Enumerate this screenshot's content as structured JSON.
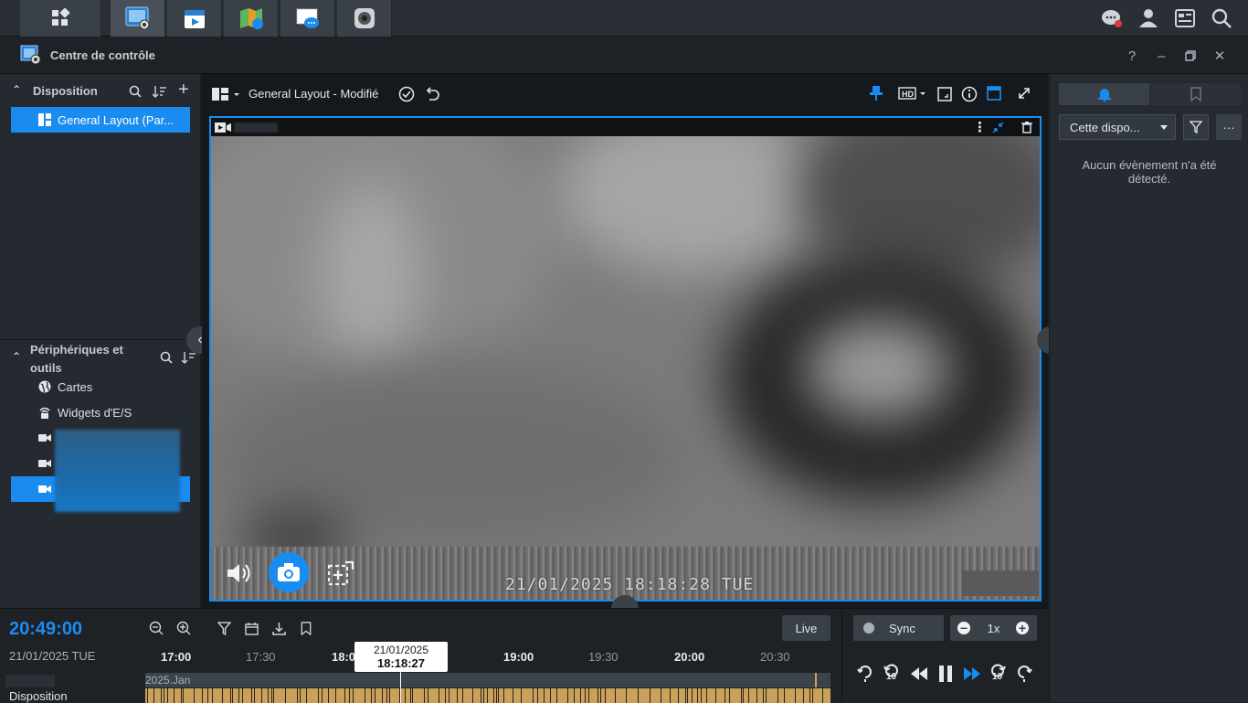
{
  "window": {
    "title": "Centre de contrôle"
  },
  "colors": {
    "accent": "#1a8cf0",
    "archive": "#c9a15a",
    "notify_dot": "#e23a3a"
  },
  "left_panel": {
    "layout_section": {
      "title": "Disposition",
      "items": [
        {
          "label": "General Layout (Par..."
        }
      ]
    },
    "devices_section": {
      "title_line1": "Périphériques et",
      "title_line2": "outils",
      "items": [
        {
          "label": "Cartes",
          "icon": "globe-icon"
        },
        {
          "label": "Widgets d'E/S",
          "icon": "io-widget-icon"
        }
      ]
    }
  },
  "center": {
    "layout_name": "General Layout - Modifié"
  },
  "video": {
    "timestamp": "21/01/2025 18:18:28 TUE"
  },
  "right_panel": {
    "filter_select": "Cette dispo...",
    "empty_message": "Aucun évènement n'a été détecté."
  },
  "timeline": {
    "current_time": "20:49:00",
    "current_date": "21/01/2025 TUE",
    "live_label": "Live",
    "cursor_date": "21/01/2025",
    "cursor_time": "18:18:27",
    "ticks": [
      {
        "label": "17:00",
        "major": true
      },
      {
        "label": "17:30",
        "major": false
      },
      {
        "label": "18:0",
        "major": true
      },
      {
        "label": "0",
        "major": false
      },
      {
        "label": "19:00",
        "major": true
      },
      {
        "label": "19:30",
        "major": false
      },
      {
        "label": "20:00",
        "major": true
      },
      {
        "label": "20:30",
        "major": false
      }
    ],
    "month_label": "2025.Jan",
    "track_label": "Disposition"
  },
  "playback": {
    "sync_label": "Sync",
    "speed": "1x",
    "skip_seconds": "10"
  }
}
